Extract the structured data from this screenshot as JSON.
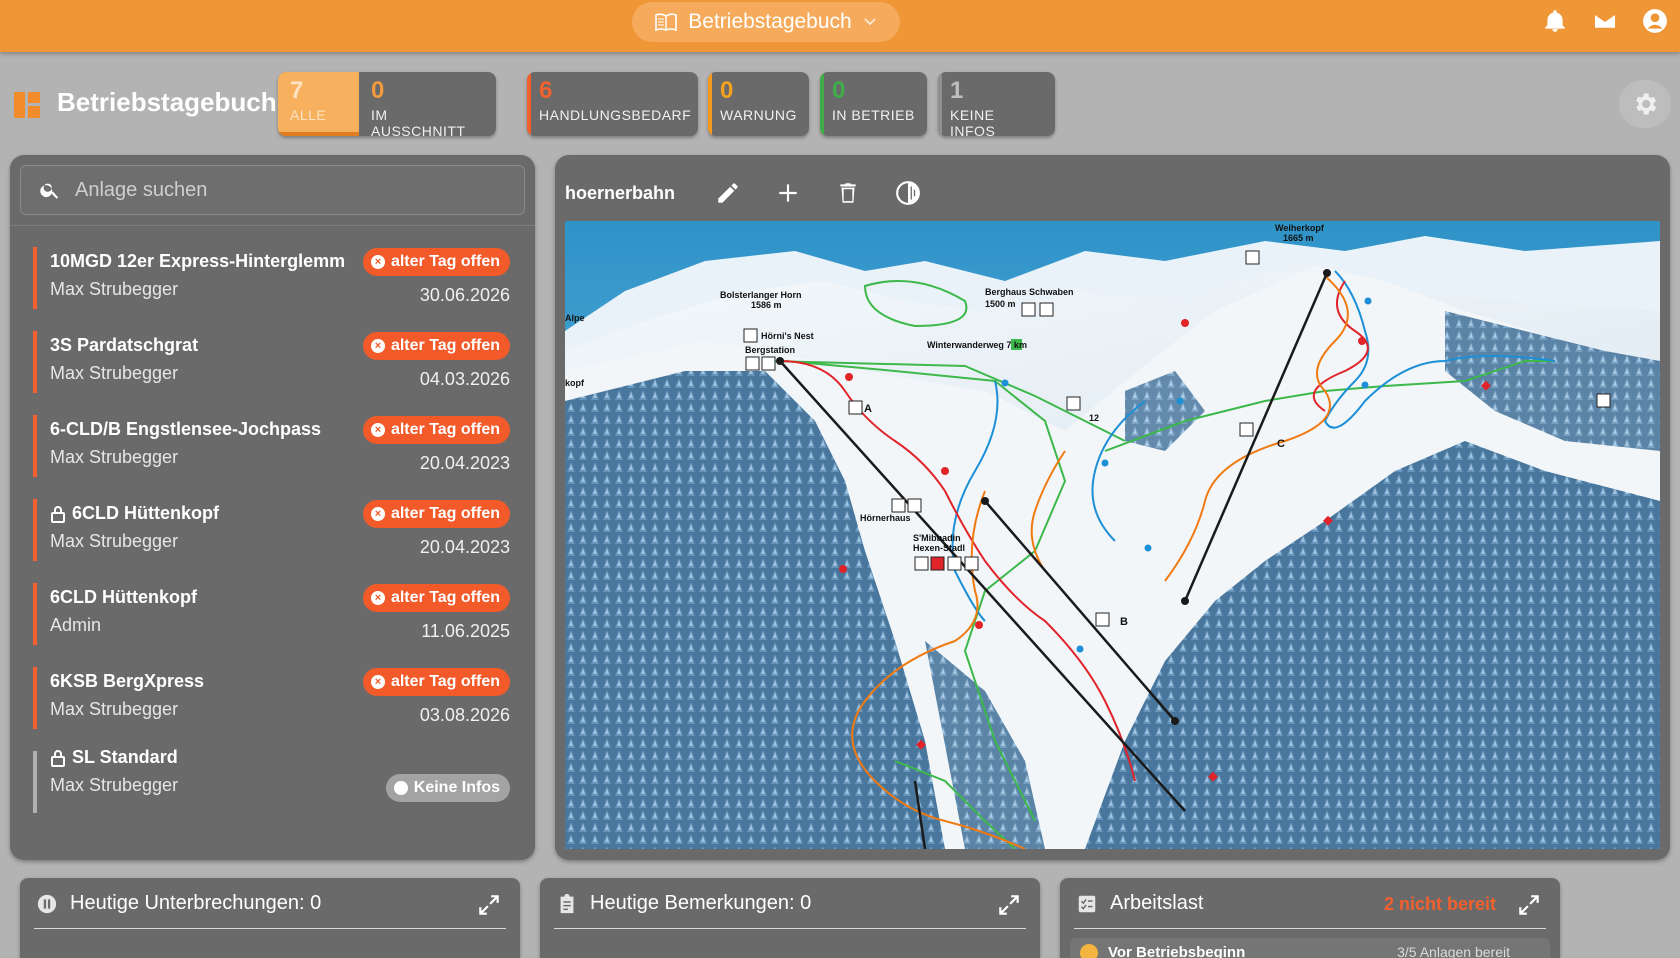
{
  "topbar": {
    "app_title": "Betriebstagebuch",
    "icons": [
      "notifications-icon",
      "mail-icon",
      "account-icon"
    ]
  },
  "header": {
    "title": "Betriebstagebuch",
    "stats": {
      "alle": {
        "count": "7",
        "label": "ALLE"
      },
      "ausschnitt": {
        "count": "0",
        "label": "IM AUSSCHNITT"
      },
      "handlungsbedarf": {
        "count": "6",
        "label": "HANDLUNGSBEDARF"
      },
      "warnung": {
        "count": "0",
        "label": "WARNUNG"
      },
      "in_betrieb": {
        "count": "0",
        "label": "IN BETRIEB"
      },
      "keine_infos": {
        "count": "1",
        "label": "KEINE INFOS"
      }
    }
  },
  "search": {
    "placeholder": "Anlage suchen"
  },
  "facilities": [
    {
      "name": "10MGD 12er Express-Hinterglemm",
      "user": "Max Strubegger",
      "status": "alter Tag offen",
      "date": "30.06.2026"
    },
    {
      "name": "3S Pardatschgrat",
      "user": "Max Strubegger",
      "status": "alter Tag offen",
      "date": "04.03.2026"
    },
    {
      "name": "6-CLD/B Engstlensee-Jochpass",
      "user": "Max Strubegger",
      "status": "alter Tag offen",
      "date": "20.04.2023"
    },
    {
      "name": "6CLD Hüttenkopf",
      "user": "Max Strubegger",
      "status": "alter Tag offen",
      "date": "20.04.2023"
    },
    {
      "name": "6CLD Hüttenkopf",
      "user": "Admin",
      "status": "alter Tag offen",
      "date": "11.06.2025"
    },
    {
      "name": "6KSB BergXpress",
      "user": "Max Strubegger",
      "status": "alter Tag offen",
      "date": "03.08.2026"
    },
    {
      "name": "SL Standard",
      "user": "Max Strubegger",
      "status": "Keine Infos",
      "date": ""
    }
  ],
  "map": {
    "name": "hoernerbahn",
    "labels": {
      "weiherkopf": "Weiherkopf",
      "weiherkopf_alt": "1665 m",
      "bolster": "Bolsterlanger Horn",
      "bolster_alt": "1586 m",
      "berghaus": "Berghaus Schwaben",
      "berghaus_alt": "1500 m",
      "hoernis": "Hörni's Nest",
      "bergstation": "Bergstation",
      "winterweg": "Winterwanderweg 7 km",
      "hoernerhaus": "Hörnerhaus",
      "mibbadin": "S'Mibbadin",
      "hexen": "Hexen-Stadl",
      "alpe": "Alpe",
      "kopf": "kopf",
      "lift_a": "A",
      "lift_b": "B",
      "lift_c": "C",
      "run_12": "12"
    },
    "colors": {
      "red_run": "#e0242a",
      "blue_run": "#1c8fd6",
      "orange_run": "#f07a12",
      "green_trail": "#3db84a",
      "lift": "#1a1a1a"
    }
  },
  "cards": {
    "unterbrechungen": {
      "title": "Heutige Unterbrechungen: 0"
    },
    "bemerkungen": {
      "title": "Heutige Bemerkungen: 0"
    },
    "arbeitslast": {
      "title": "Arbeitslast",
      "warning": "2 nicht bereit",
      "sub_label": "Vor Betriebsbeginn",
      "sub_info": "3/5 Anlagen bereit"
    }
  }
}
